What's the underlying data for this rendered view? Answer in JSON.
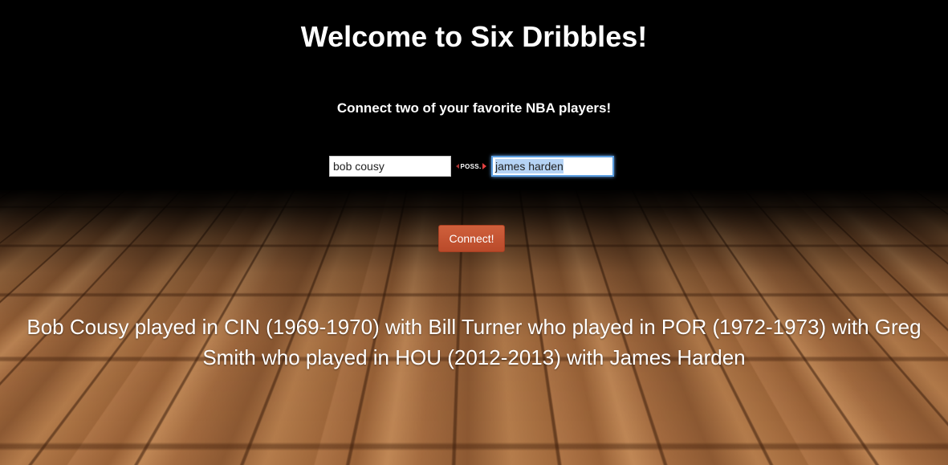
{
  "page": {
    "title": "Welcome to Six Dribbles!",
    "subtitle": "Connect two of your favorite NBA players!"
  },
  "form": {
    "player_one_value": "bob cousy",
    "connector_label": "POSS.",
    "player_two_value": "james harden",
    "connect_label": "Connect!"
  },
  "result": {
    "text": "Bob Cousy played in CIN (1969-1970) with Bill Turner who played in POR (1972-1973) with Greg Smith who played in HOU (2012-2013) with James Harden"
  },
  "colors": {
    "button": "#c45533",
    "focus_ring": "#5b9ee0",
    "poss_arrow": "#e34040"
  }
}
